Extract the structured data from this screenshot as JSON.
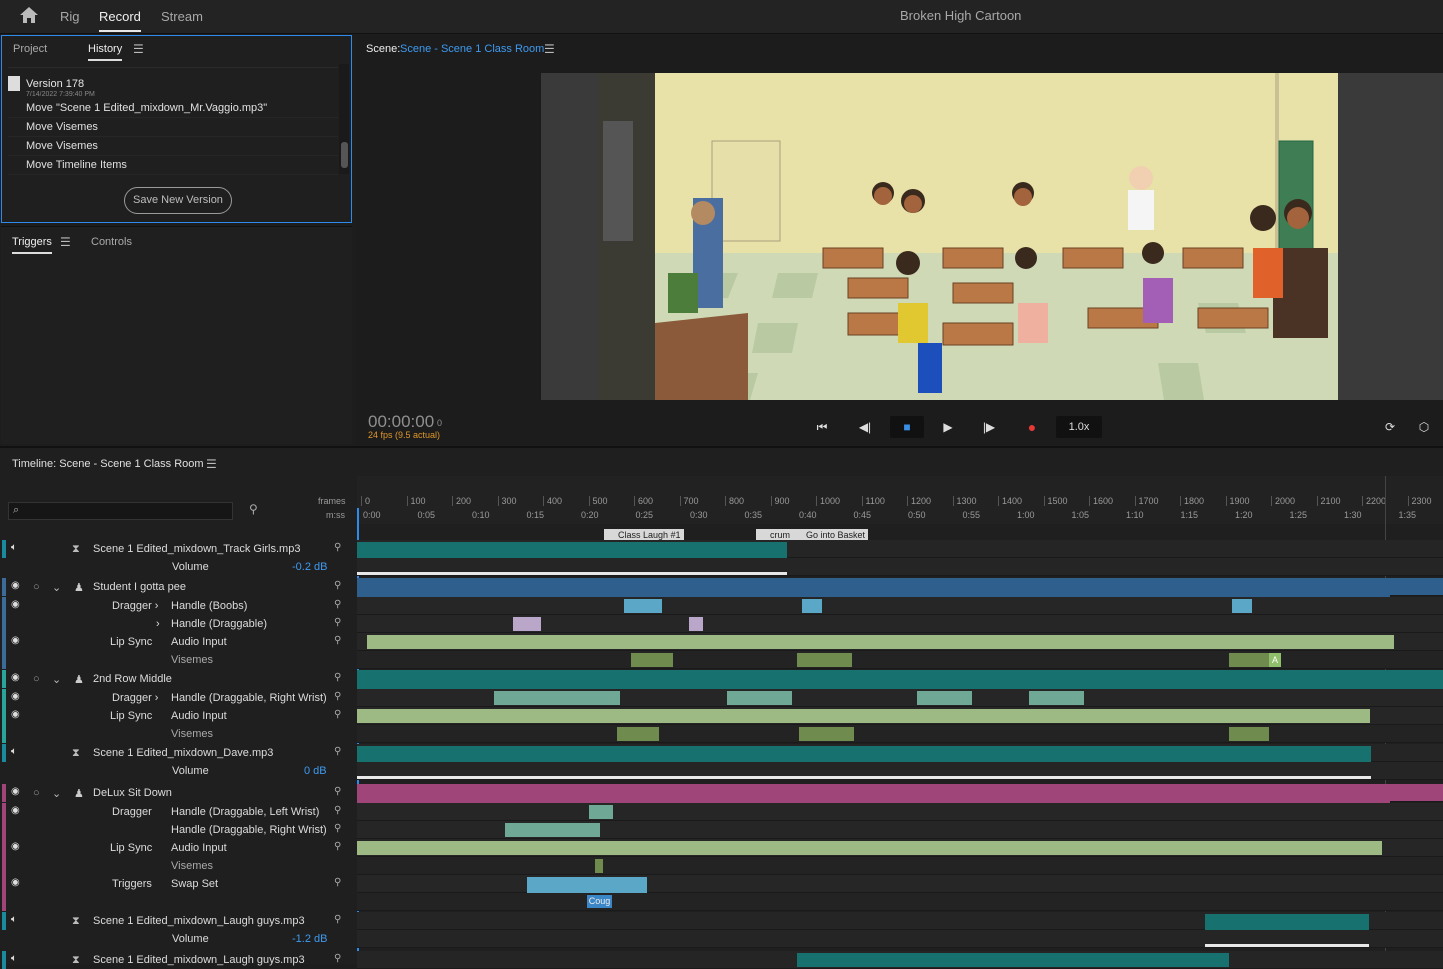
{
  "topbar": {
    "tabs": [
      "Rig",
      "Record",
      "Stream"
    ],
    "active_tab": "Record",
    "project_title": "Broken High Cartoon"
  },
  "history_panel": {
    "tabs": [
      "Project",
      "History"
    ],
    "version_label": "Version 178",
    "version_date": "7/14/2022 7:39:40 PM",
    "items": [
      "Move \"Scene 1 Edited_mixdown_Mr.Vaggio.mp3\"",
      "Move Visemes",
      "Move Visemes",
      "Move Timeline Items"
    ],
    "save_button": "Save New Version"
  },
  "triggers_panel": {
    "tabs": [
      "Triggers",
      "Controls"
    ]
  },
  "scene_panel": {
    "label": "Scene:",
    "scene_link": "Scene - Scene 1 Class Room",
    "timecode": "00:00:00",
    "frame": "0",
    "fps": "24 fps (9.5 actual)",
    "speed": "1.0x"
  },
  "timeline": {
    "title": "Timeline: Scene - Scene 1 Class Room",
    "ruler_label_frames": "frames",
    "ruler_label_mss": "m:ss",
    "frames": [
      "0",
      "100",
      "200",
      "300",
      "400",
      "500",
      "600",
      "700",
      "800",
      "900",
      "1000",
      "1100",
      "1200",
      "1300",
      "1400",
      "1500",
      "1600",
      "1700",
      "1800",
      "1900",
      "2000",
      "2100",
      "2200",
      "2300"
    ],
    "times": [
      "0:00",
      "0:05",
      "0:10",
      "0:15",
      "0:20",
      "0:25",
      "0:30",
      "0:35",
      "0:40",
      "0:45",
      "0:50",
      "0:55",
      "1:00",
      "1:05",
      "1:10",
      "1:15",
      "1:20",
      "1:25",
      "1:30",
      "1:35"
    ],
    "markers": [
      "Class Laugh #1",
      "crum",
      "Go into Basket"
    ],
    "rows": {
      "audio1": {
        "name": "Scene 1 Edited_mixdown_Track Girls.mp3",
        "sub": "Volume",
        "db": "-0.2 dB"
      },
      "puppet1": {
        "name": "Student I gotta pee"
      },
      "p1_dragger": {
        "label": "Dragger",
        "handle": "Handle (Boobs)"
      },
      "p1_handle2": {
        "handle": "Handle (Draggable)"
      },
      "p1_lipsync": {
        "label": "Lip Sync",
        "input": "Audio Input"
      },
      "p1_visemes": {
        "label": "Visemes"
      },
      "puppet2": {
        "name": "2nd Row Middle"
      },
      "p2_dragger": {
        "label": "Dragger",
        "handle": "Handle (Draggable, Right Wrist)"
      },
      "p2_lipsync": {
        "label": "Lip Sync",
        "input": "Audio Input"
      },
      "p2_visemes": {
        "label": "Visemes"
      },
      "audio2": {
        "name": "Scene 1 Edited_mixdown_Dave.mp3",
        "sub": "Volume",
        "db": "0 dB"
      },
      "puppet3": {
        "name": "DeLux Sit Down"
      },
      "p3_dragger": {
        "label": "Dragger",
        "handle": "Handle (Draggable, Left Wrist)"
      },
      "p3_handle2": {
        "handle": "Handle (Draggable, Right Wrist)"
      },
      "p3_lipsync": {
        "label": "Lip Sync",
        "input": "Audio Input"
      },
      "p3_visemes": {
        "label": "Visemes"
      },
      "p3_triggers": {
        "label": "Triggers",
        "input": "Swap Set"
      },
      "audio3": {
        "name": "Scene 1 Edited_mixdown_Laugh guys.mp3",
        "sub": "Volume",
        "db": "-1.2 dB"
      },
      "audio4": {
        "name": "Scene 1 Edited_mixdown_Laugh guys.mp3"
      }
    },
    "clip_labels": {
      "coug": "Coug",
      "viseme_a": "A"
    }
  },
  "colors": {
    "accent": "#2d8ceb",
    "audio_clip": "#16716f",
    "puppet_blue": "#2f5f8d",
    "lipsync_green": "#9dba84",
    "dragger_clip": "#5aa7c8",
    "pink": "#a0457a",
    "record": "#e53935"
  }
}
